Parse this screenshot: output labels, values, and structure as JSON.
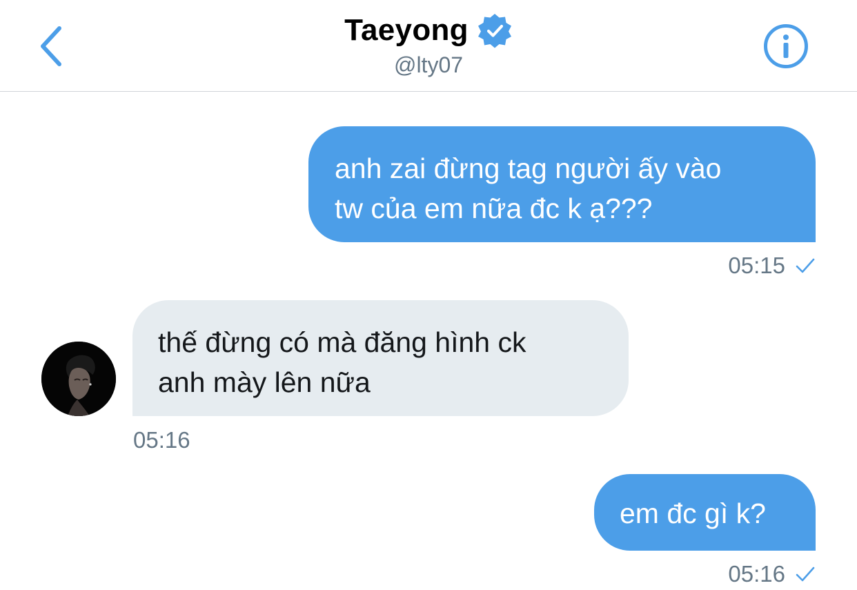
{
  "header": {
    "name": "Taeyong",
    "handle": "@lty07",
    "back_icon": "chevron-left-icon",
    "verified_icon": "verified-badge-icon",
    "info_icon": "info-icon",
    "accent_color": "#4c9ee8"
  },
  "messages": [
    {
      "direction": "sent",
      "lines": [
        "anh zai đừng tag người ấy vào",
        "tw của em nữa đc k ạ???"
      ],
      "time": "05:15",
      "status_icon": "check-icon"
    },
    {
      "direction": "received",
      "lines": [
        "thế đừng có mà đăng hình ck",
        "anh mày lên nữa"
      ],
      "time": "05:16",
      "avatar_icon": "avatar"
    },
    {
      "direction": "sent",
      "lines": [
        "em đc gì k?"
      ],
      "time": "05:16",
      "status_icon": "check-icon"
    }
  ],
  "colors": {
    "sent_bubble": "#4c9ee8",
    "received_bubble": "#e6ecf0",
    "meta_text": "#657786"
  }
}
